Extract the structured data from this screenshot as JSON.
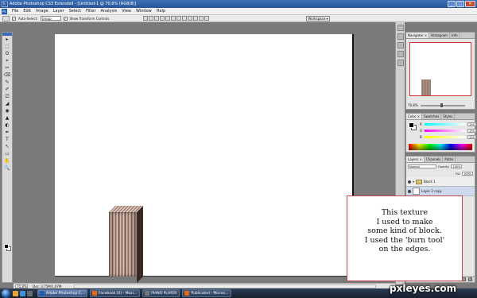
{
  "window": {
    "title": "Adobe Photoshop CS3 Extended - [Untitled-1 @ 70,8% (RGB/8)]",
    "app_badge": "Ps",
    "controls": [
      "_",
      "□",
      "✕"
    ]
  },
  "menu": [
    "File",
    "Edit",
    "Image",
    "Layer",
    "Select",
    "Filter",
    "Analysis",
    "View",
    "Window",
    "Help"
  ],
  "options_bar": {
    "auto_select_label": "Auto-Select:",
    "auto_select_value": "Group",
    "transform_controls_label": "Show Transform Controls",
    "workspace_label": "Workspace ▾"
  },
  "tools": [
    "▸",
    "⬚",
    "ʘ",
    "⌖",
    "✂",
    "⌫",
    "✎",
    "✐",
    "⎚",
    "◢",
    "◉",
    "▲",
    "◐",
    "✒",
    "T",
    "↖",
    "▭",
    "✋",
    "🔍"
  ],
  "status": {
    "zoom": "70,8%",
    "doc_info": "Doc: 3,75M/1,07M"
  },
  "navigator": {
    "tabs": [
      "Navigator ×",
      "Histogram",
      "Info"
    ],
    "zoom": "70,8%"
  },
  "color_panel": {
    "tabs": [
      "Color ×",
      "Swatches",
      "Styles"
    ],
    "channels": [
      {
        "label": "R",
        "value": "255",
        "gradient": "linear-gradient(90deg,#00ffff,#ffffff)"
      },
      {
        "label": "G",
        "value": "255",
        "gradient": "linear-gradient(90deg,#ff00ff,#ffffff)"
      },
      {
        "label": "B",
        "value": "255",
        "gradient": "linear-gradient(90deg,#ffff00,#ffffff)"
      }
    ]
  },
  "layers_panel": {
    "tabs": [
      "Layers ×",
      "Channels",
      "Paths"
    ],
    "blend_mode": "Normal",
    "opacity_label": "Opacity:",
    "opacity_value": "100%",
    "fill_label": "Fill:",
    "fill_value": "100%",
    "layers": [
      {
        "name": "Block 1",
        "type": "group"
      },
      {
        "name": "Layer 2 copy",
        "type": "layer"
      }
    ]
  },
  "note": {
    "lines": [
      "This texture",
      "I used to make",
      "some kind of block.",
      "I used the 'burn tool'",
      "on the edges."
    ]
  },
  "taskbar": {
    "quick_launch_colors": [
      "#e8a33a",
      "#3f8fd8",
      "#6a6a6a"
    ],
    "tasks": [
      {
        "label": "Adobe Photoshop C...",
        "color": "#1d5fb0",
        "active": true
      },
      {
        "label": "Facebook (0) - Mozi...",
        "color": "#e06a1a",
        "active": false
      },
      {
        "label": "PIANO PLAYER",
        "color": "#777777",
        "active": false
      },
      {
        "label": "Publicated - Micros...",
        "color": "#e06a1a",
        "active": false
      }
    ]
  },
  "watermark": "pxleyes.com"
}
